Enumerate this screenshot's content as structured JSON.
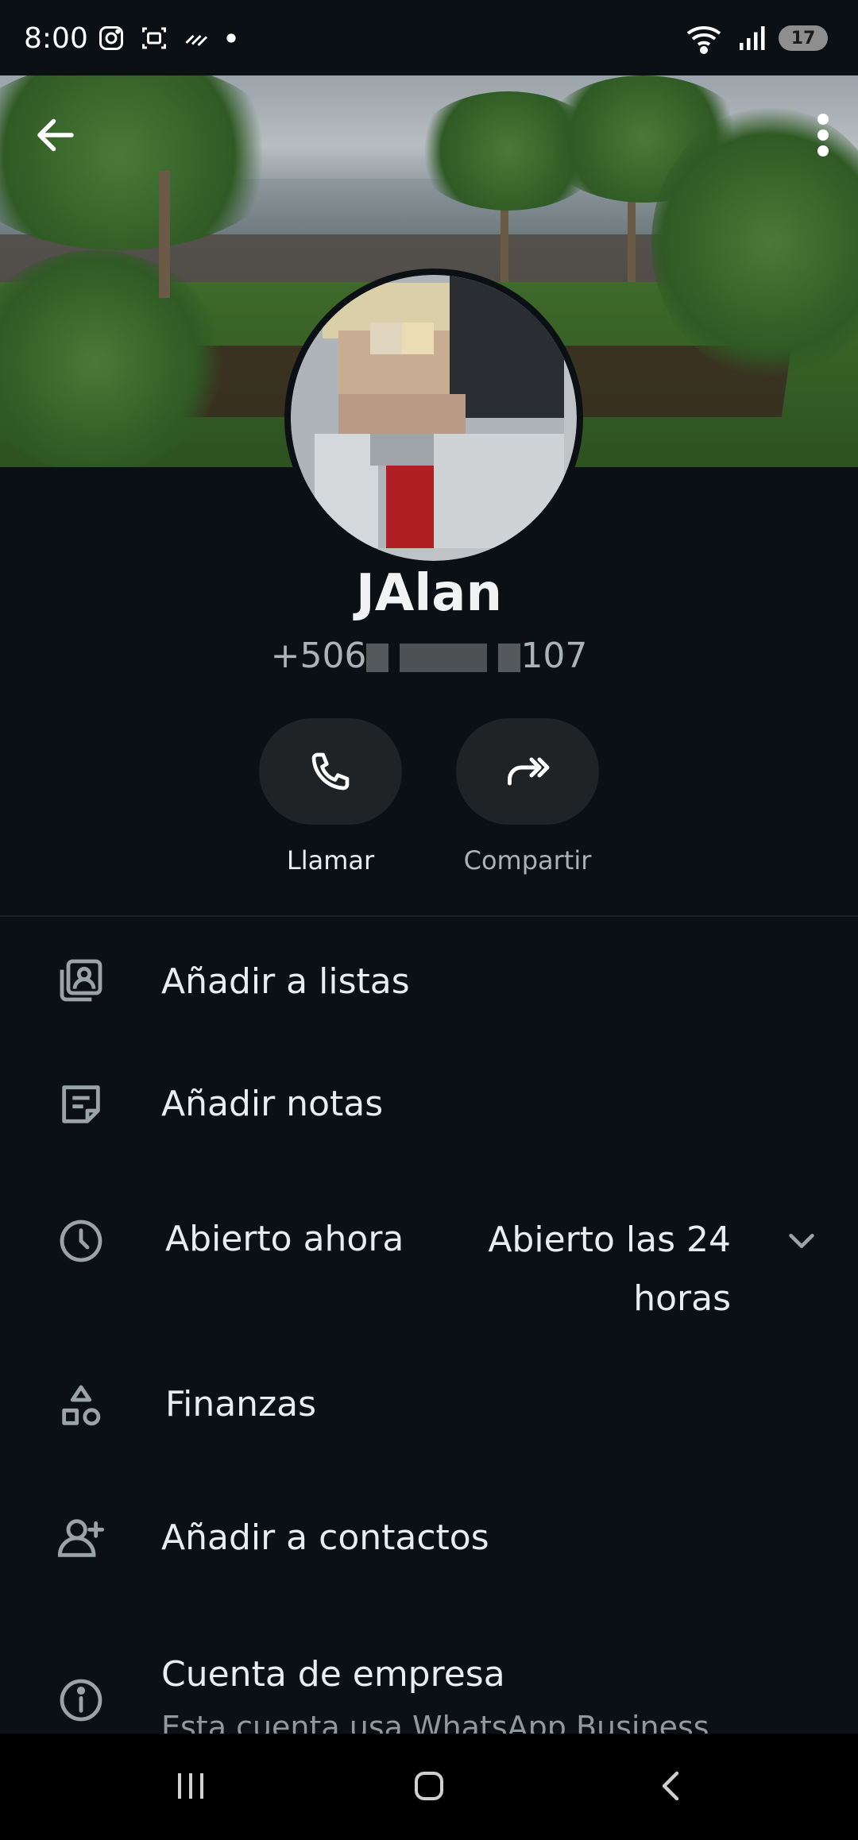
{
  "status_bar": {
    "time": "8:00",
    "battery": "17"
  },
  "contact": {
    "name": "JAlan",
    "phone_prefix": "+506",
    "phone_suffix": "107"
  },
  "actions": {
    "call_label": "Llamar",
    "share_label": "Compartir"
  },
  "menu": {
    "add_to_lists": "Añadir a listas",
    "add_notes": "Añadir notas",
    "hours_status": "Abierto ahora",
    "hours_detail": "Abierto las 24 horas",
    "category": "Finanzas",
    "add_to_contacts": "Añadir a contactos",
    "business_account_title": "Cuenta de empresa",
    "business_account_sub": "Esta cuenta usa WhatsApp Business"
  },
  "colors": {
    "background": "#0b1014",
    "accent_green": "#21c063",
    "button_bg": "#1f2326",
    "icon_gray": "#8f999e"
  },
  "icons": {
    "back": "arrow-left-icon",
    "menu": "more-vertical-icon",
    "call": "phone-icon",
    "share": "share-forward-icon",
    "lists": "lists-icon",
    "notes": "notes-icon",
    "hours": "clock-icon",
    "category": "shapes-icon",
    "add_contact": "person-add-icon",
    "info": "info-icon",
    "chevron": "chevron-down-icon"
  }
}
